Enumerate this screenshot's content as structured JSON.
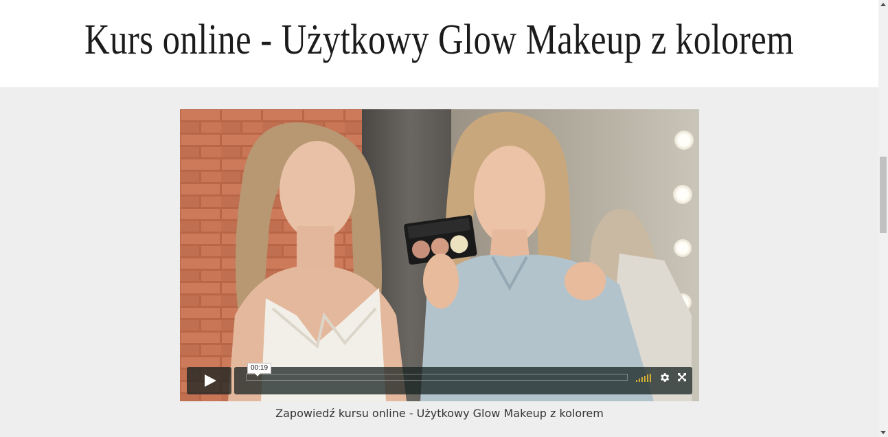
{
  "page": {
    "title": "Kurs online - Użytkowy Glow Makeup z kolorem"
  },
  "video": {
    "hover_time": "00:19",
    "caption": "Zapowiedź kursu online - Użytkowy Glow Makeup z kolorem",
    "icons": {
      "play": "play-icon",
      "volume": "volume-icon",
      "settings": "gear-icon",
      "fullscreen": "fullscreen-icon"
    },
    "accent_color": "#d4b030"
  }
}
